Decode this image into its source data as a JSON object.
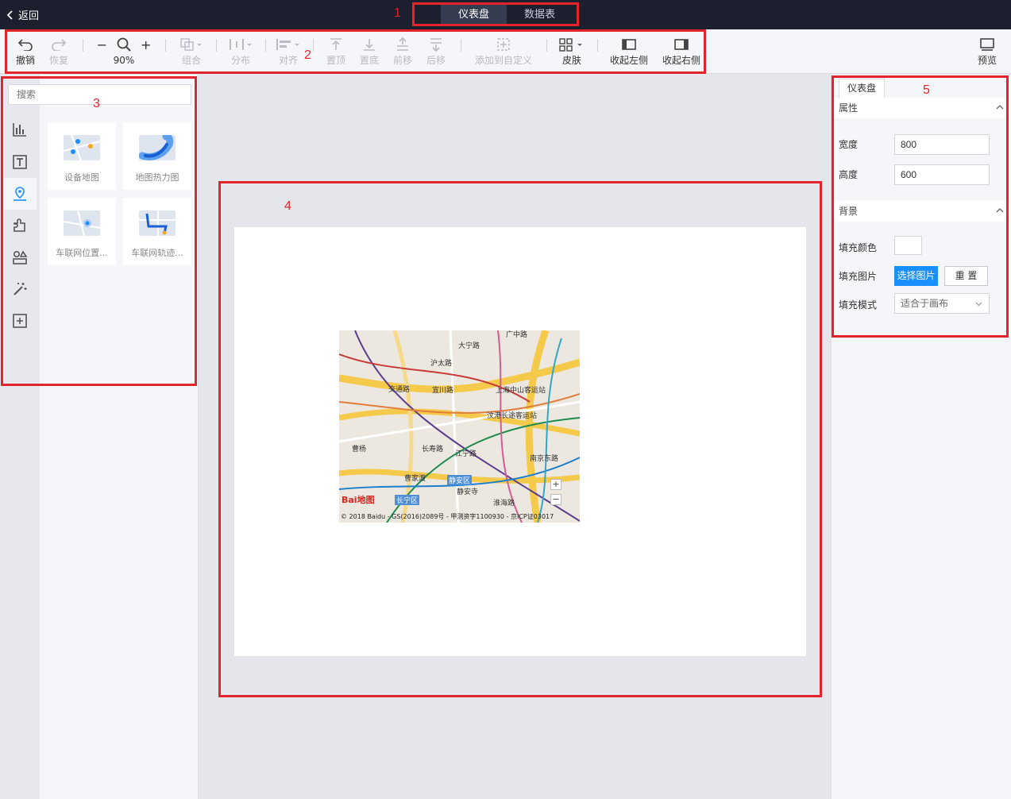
{
  "topbar": {
    "back_label": "返回",
    "tabs": [
      {
        "label": "仪表盘",
        "active": true
      },
      {
        "label": "数据表",
        "active": false
      }
    ]
  },
  "toolbar": {
    "undo": "撤销",
    "redo": "恢复",
    "zoom": "90%",
    "group": "组合",
    "distribute": "分布",
    "align": "对齐",
    "top": "置顶",
    "bottom": "置底",
    "forward": "前移",
    "backward": "后移",
    "add_custom": "添加到自定义",
    "skin": "皮肤",
    "collapse_left": "收起左侧",
    "collapse_right": "收起右侧",
    "preview": "预览"
  },
  "left_panel": {
    "search_placeholder": "搜索",
    "categories": [
      "chart-icon",
      "text-icon",
      "map-icon",
      "plugin-icon",
      "shapes-icon",
      "magic-icon",
      "custom-icon"
    ],
    "components": [
      {
        "name": "设备地图"
      },
      {
        "name": "地图热力图"
      },
      {
        "name": "车联网位置..."
      },
      {
        "name": "车联网轨迹..."
      }
    ]
  },
  "map": {
    "labels": [
      "大宁路",
      "广中路",
      "交通路",
      "宜川路",
      "上海中山客运站",
      "沪太路",
      "汶港长途客运站",
      "曹杨",
      "长寿路",
      "江宁路",
      "南京东路",
      "曹家渡",
      "静安区",
      "静安寺",
      "长宁区",
      "淮海路"
    ],
    "logo": "Bai地图",
    "copyright": "© 2018 Baidu - GS(2016)2089号 - 甲测资字1100930 - 京ICP证03017"
  },
  "right_panel": {
    "tab": "仪表盘",
    "properties": {
      "title": "属性",
      "width_label": "宽度",
      "width_value": "800",
      "height_label": "高度",
      "height_value": "600"
    },
    "background": {
      "title": "背景",
      "fill_color_label": "填充颜色",
      "fill_color_value": "#ffffff",
      "fill_image_label": "填充图片",
      "select_image_button": "选择图片",
      "reset_button": "重 置",
      "fill_mode_label": "填充模式",
      "fill_mode_value": "适合于画布"
    }
  },
  "annotations": [
    "1",
    "2",
    "3",
    "4",
    "5"
  ],
  "colors": {
    "accent": "#1890ff",
    "annotation": "#e3242b",
    "topbar": "#1b1f2e"
  }
}
